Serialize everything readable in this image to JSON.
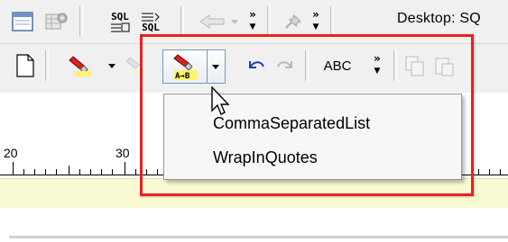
{
  "toolbar_row1": {
    "sql_button_top": "SQL",
    "sql_button_bottom": "SQL",
    "overflow_label": "»",
    "desktop_label": "Desktop: SQ"
  },
  "toolbar_row2": {
    "spell_label": "ABC",
    "overflow_label": "»",
    "format_button_caption": "A→B"
  },
  "ruler": {
    "ticks": [
      "20",
      "30"
    ]
  },
  "dropdown_menu": {
    "items": [
      "CommaSeparatedList",
      "WrapInQuotes"
    ]
  },
  "colors": {
    "highlight_box": "#e8211e",
    "editor_band": "#fafad2",
    "toolbar_bg": "#f0f0f0"
  }
}
